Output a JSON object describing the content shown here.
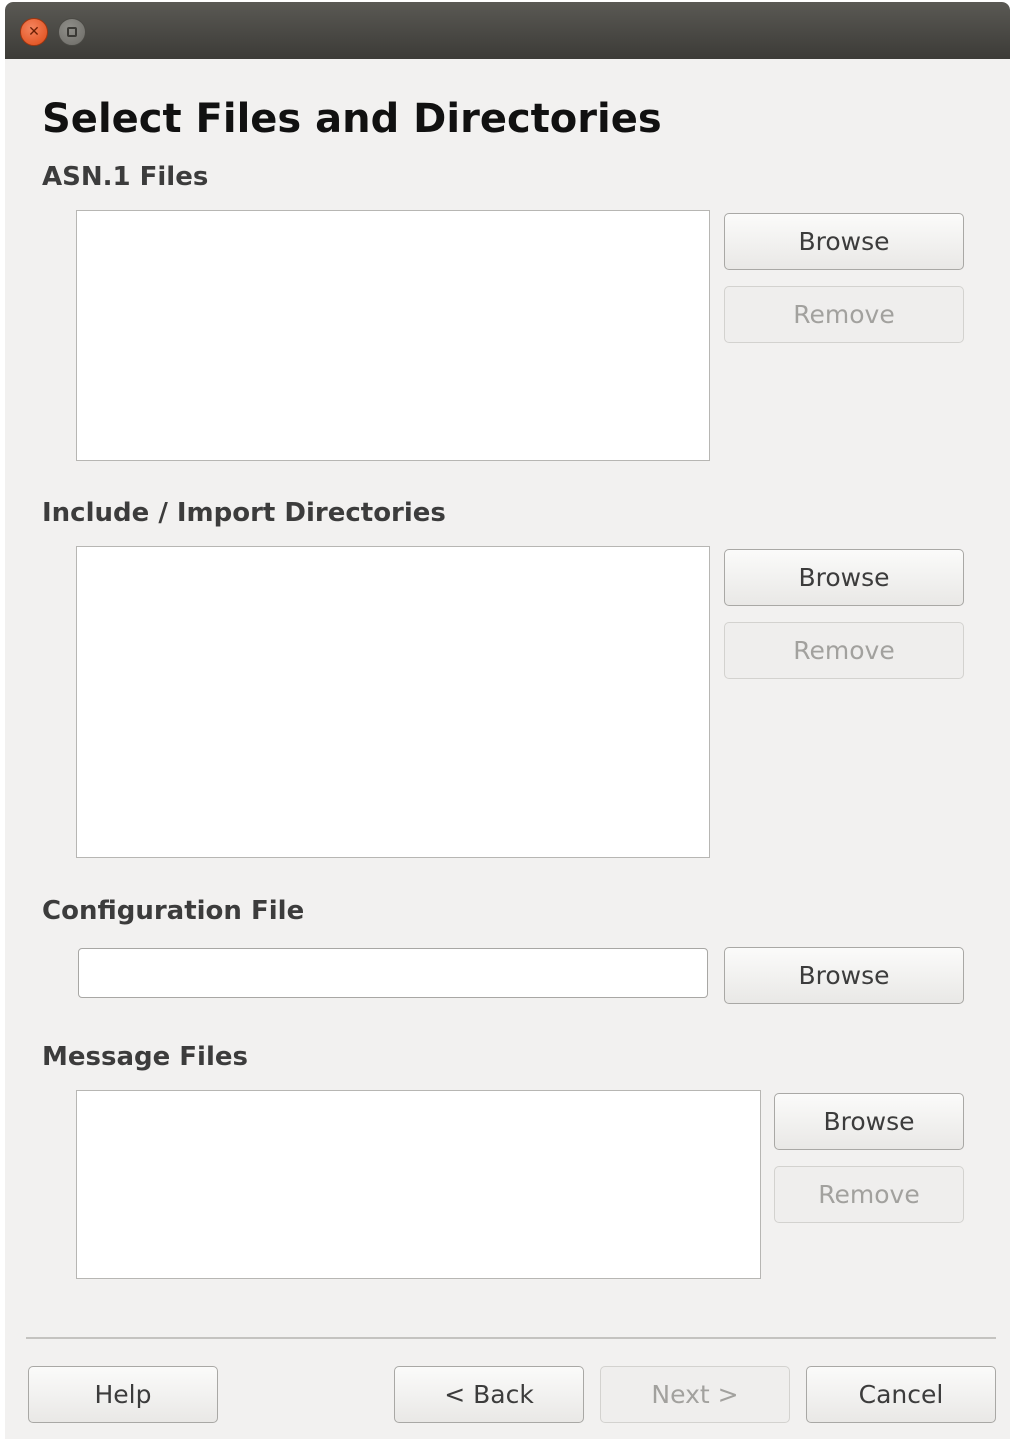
{
  "window": {
    "controls": [
      "close-icon",
      "minimize-icon"
    ]
  },
  "page": {
    "title": "Select Files and Directories"
  },
  "asn1_files": {
    "label": "ASN.1 Files",
    "browse_label": "Browse",
    "remove_label": "Remove"
  },
  "include_dirs": {
    "label": "Include / Import Directories",
    "browse_label": "Browse",
    "remove_label": "Remove"
  },
  "config_file": {
    "label": "Configuration File",
    "value": "",
    "browse_label": "Browse"
  },
  "message_files": {
    "label": "Message Files",
    "browse_label": "Browse",
    "remove_label": "Remove"
  },
  "footer": {
    "help_label": "Help",
    "back_label": "< Back",
    "next_label": "Next >",
    "cancel_label": "Cancel"
  },
  "colors": {
    "window_bg": "#f2f1f0",
    "titlebar": "#3c3b37",
    "close_button": "#df4a16",
    "disabled_text": "#a2a19e"
  }
}
